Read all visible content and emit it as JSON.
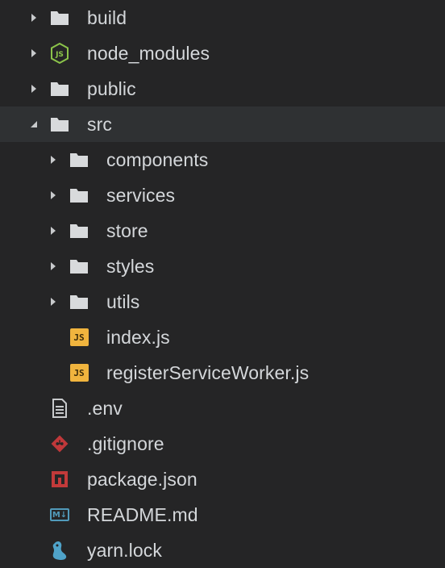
{
  "colors": {
    "background": "#252526",
    "selected_row": "#2f3133",
    "text": "#d4d7da",
    "folder": "#d8dadc",
    "node": "#8bc34a",
    "js_badge": "#f0b43e",
    "git": "#e0493f",
    "npm": "#c23a3a",
    "markdown": "#519aba",
    "yarn": "#4fa3c9"
  },
  "tree": [
    {
      "label": "build",
      "icon": "folder-icon",
      "expanded": false
    },
    {
      "label": "node_modules",
      "icon": "nodejs-icon",
      "expanded": false
    },
    {
      "label": "public",
      "icon": "folder-icon",
      "expanded": false
    },
    {
      "label": "src",
      "icon": "folder-icon",
      "expanded": true,
      "children": [
        {
          "label": "components",
          "icon": "folder-icon",
          "expanded": false
        },
        {
          "label": "services",
          "icon": "folder-icon",
          "expanded": false
        },
        {
          "label": "store",
          "icon": "folder-icon",
          "expanded": false
        },
        {
          "label": "styles",
          "icon": "folder-icon",
          "expanded": false
        },
        {
          "label": "utils",
          "icon": "folder-icon",
          "expanded": false
        },
        {
          "label": "index.js",
          "icon": "javascript-icon",
          "badge": "JS"
        },
        {
          "label": "registerServiceWorker.js",
          "icon": "javascript-icon",
          "badge": "JS"
        }
      ]
    },
    {
      "label": ".env",
      "icon": "document-icon"
    },
    {
      "label": ".gitignore",
      "icon": "git-icon"
    },
    {
      "label": "package.json",
      "icon": "npm-icon"
    },
    {
      "label": "README.md",
      "icon": "markdown-icon",
      "badge": "M↓"
    },
    {
      "label": "yarn.lock",
      "icon": "yarn-icon"
    }
  ]
}
